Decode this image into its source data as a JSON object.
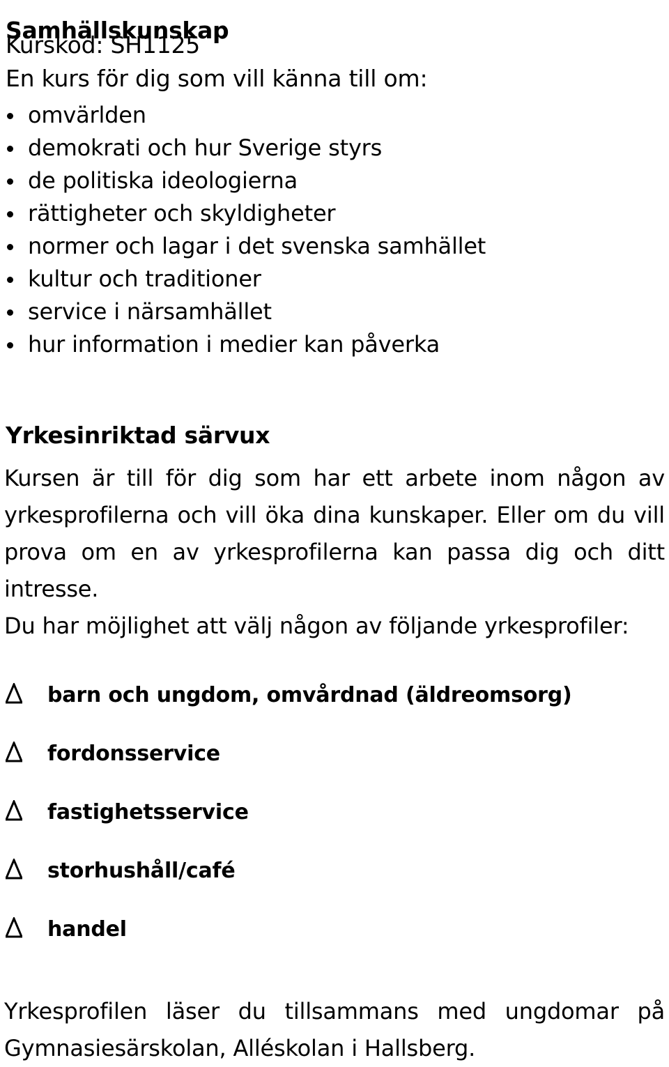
{
  "document": {
    "title": "Samhällskunskap",
    "course_code_line": "Kurskod: SH1125",
    "intro_line": "En kurs för dig som vill känna till om:",
    "topics": [
      "omvärlden",
      "demokrati och hur Sverige styrs",
      "de politiska ideologierna",
      "rättigheter och skyldigheter",
      "normer och lagar i det svenska samhället",
      "kultur och traditioner",
      "service i närsamhället",
      "hur information i medier kan påverka"
    ],
    "section_heading": "Yrkesinriktad särvux",
    "section_paragraph": "Kursen är till för dig som har ett arbete inom någon av yrkesprofilerna och vill öka dina kunskaper. Eller om du vill prova om en av yrkesprofilerna kan passa dig och ditt intresse.",
    "choice_lead": "Du har möjlighet att välj någon av följande yrkesprofiler:",
    "profiles": [
      "barn och ungdom, omvårdnad (äldreomsorg)",
      "fordonsservice",
      "fastighetsservice",
      "storhushåll/café",
      "handel"
    ],
    "closing_paragraph": "Yrkesprofilen läser du tillsammans med ungdomar på Gymnasiesärskolan, Alléskolan i Hallsberg.",
    "bullet_glyph": "bullet-dot-icon",
    "profile_glyph": "triangle-icon",
    "colors": {
      "text": "#000000",
      "background": "#ffffff"
    }
  }
}
